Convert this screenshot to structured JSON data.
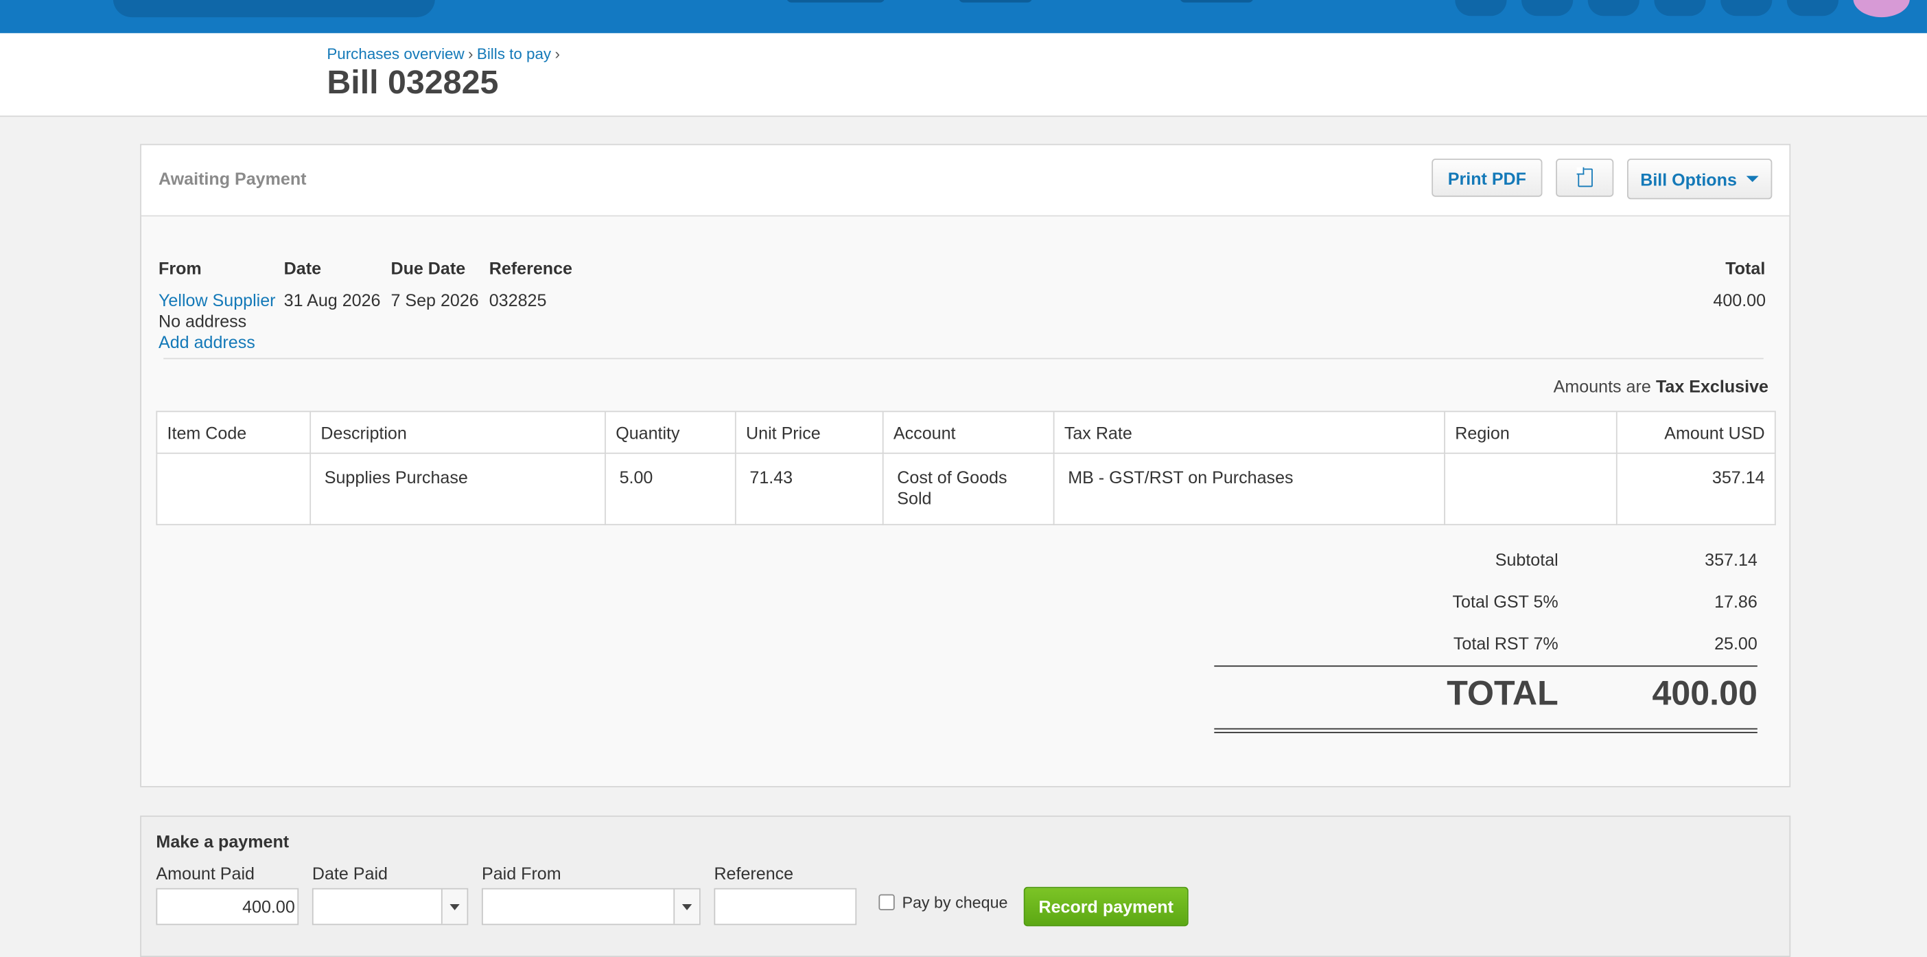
{
  "breadcrumb": {
    "items": [
      "Purchases overview",
      "Bills to pay"
    ],
    "separator": "›"
  },
  "page_title": "Bill 032825",
  "bill": {
    "status": "Awaiting Payment",
    "actions": {
      "print_pdf": "Print PDF",
      "copy_icon": "document-copy-icon",
      "bill_options": "Bill Options"
    },
    "headers": {
      "from": "From",
      "date": "Date",
      "due_date": "Due Date",
      "reference": "Reference",
      "total": "Total"
    },
    "from": {
      "supplier": "Yellow Supplier",
      "address": "No address",
      "add_address": "Add address"
    },
    "date": "31 Aug 2026",
    "due_date": "7 Sep 2026",
    "reference": "032825",
    "total": "400.00",
    "amounts_are_label": "Amounts are",
    "amounts_are_value": "Tax Exclusive",
    "columns": [
      "Item Code",
      "Description",
      "Quantity",
      "Unit Price",
      "Account",
      "Tax Rate",
      "Region",
      "Amount USD"
    ],
    "lines": [
      {
        "item_code": "",
        "description": "Supplies Purchase",
        "quantity": "5.00",
        "unit_price": "71.43",
        "account": "Cost of Goods Sold",
        "tax_rate": "MB - GST/RST on Purchases",
        "region": "",
        "amount": "357.14"
      }
    ],
    "totals": {
      "subtotal_label": "Subtotal",
      "subtotal": "357.14",
      "gst_label": "Total GST 5%",
      "gst": "17.86",
      "rst_label": "Total RST 7%",
      "rst": "25.00",
      "grand_label": "TOTAL",
      "grand": "400.00"
    }
  },
  "payment": {
    "title": "Make a payment",
    "amount_paid_label": "Amount Paid",
    "amount_paid_value": "400.00",
    "date_paid_label": "Date Paid",
    "date_paid_value": "",
    "paid_from_label": "Paid From",
    "paid_from_value": "",
    "reference_label": "Reference",
    "reference_value": "",
    "pay_by_cheque_label": "Pay by cheque",
    "pay_by_cheque_checked": false,
    "record_button": "Record payment"
  },
  "colors": {
    "topbar": "#1379c2",
    "link": "#1479b8",
    "record_button": "#6cb61e",
    "avatar": "#d79ad6"
  }
}
